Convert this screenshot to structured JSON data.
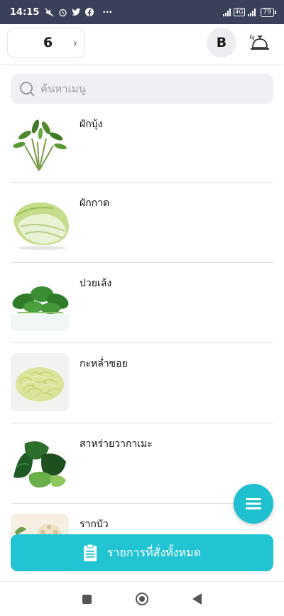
{
  "status_bar": {
    "time": "14:15",
    "icons": [
      "mute-icon",
      "alarm-icon",
      "twitter-icon",
      "facebook-icon",
      "more-dots-icon"
    ],
    "more": "···",
    "battery": "79"
  },
  "header": {
    "table_number": "6",
    "chevron": "›",
    "avatar_initial": "B",
    "bell_icon": "service-bell-icon"
  },
  "search": {
    "placeholder": "ค้นหาเมนู"
  },
  "menu_items": [
    {
      "name": "ผักบุ้ง"
    },
    {
      "name": "ผักกาด"
    },
    {
      "name": "ปวยเล้ง"
    },
    {
      "name": "กะหล่ำซอย"
    },
    {
      "name": "สาหร่ายวากาเมะ"
    },
    {
      "name": "รากบัว"
    }
  ],
  "bottom_button": {
    "label": "รายการที่สั่งทั้งหมด",
    "icon": "clipboard-icon"
  },
  "colors": {
    "accent": "#22c4d3",
    "status_bar": "#3a3f5a"
  }
}
